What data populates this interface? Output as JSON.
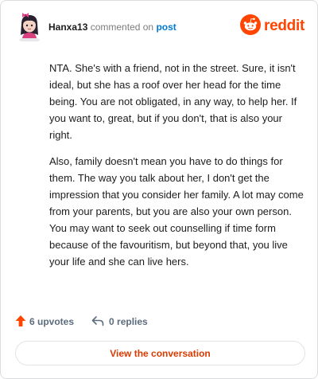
{
  "comment": {
    "username": "Hanxa13",
    "action_text": "commented on",
    "post_link_text": "post",
    "paragraphs": [
      "NTA. She's with a friend, not in the street. Sure, it isn't ideal, but she has a roof over her head for the time being. You are not obligated, in any way, to help her. If you want to, great, but if you don't, that is also your right.",
      "Also, family doesn't mean you have to do things for them. The way you talk about her, I don't get the impression that you consider her family. A lot may come from your parents, but you are also your own person. You may want to seek out counselling if time form because of the favouritism, but beyond that, you live your life and she can live hers."
    ]
  },
  "brand": {
    "name": "reddit",
    "icon": "reddit-snoo-icon",
    "color": "#ff4500"
  },
  "footer": {
    "upvotes_label": "6 upvotes",
    "replies_label": "0 replies",
    "upvote_icon": "upvote-arrow-icon",
    "reply_icon": "reply-arrow-icon",
    "upvote_color": "#ff4500"
  },
  "cta": {
    "label": "View the conversation",
    "color": "#d93a00"
  },
  "colors": {
    "link": "#0079d3",
    "muted": "#7c7c7c",
    "border": "#d9dde0"
  }
}
